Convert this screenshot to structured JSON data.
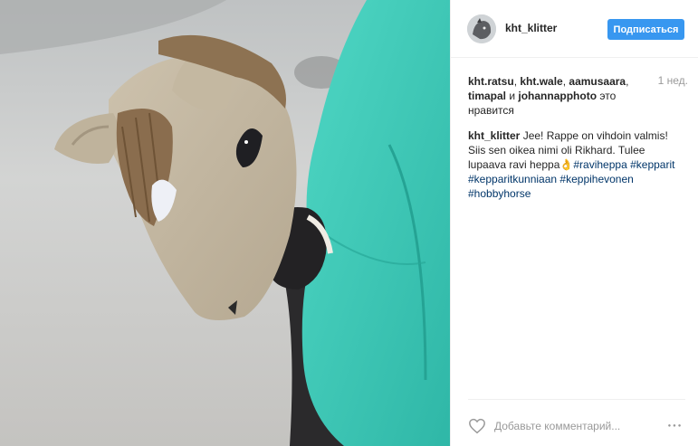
{
  "post": {
    "author": "kht_klitter",
    "follow_label": "Подписаться",
    "timestamp": "1 нед.",
    "photo_subject": "hobby horse",
    "avatar_subject": "hobby horse"
  },
  "likes": {
    "users": [
      "kht.ratsu",
      "kht.wale",
      "aamusaara",
      "timapal",
      "johannapphoto"
    ],
    "sep1": ", ",
    "sep2": ", ",
    "sep3": ",",
    "sep4": " и ",
    "suffix": " это нравится"
  },
  "caption": {
    "username": "kht_klitter",
    "text": " Jee! Rappe on vihdoin valmis! Siis sen oikea nimi oli Rikhard. Tulee lupaava ravi heppa",
    "emoji": "👌",
    "hashtags": [
      "#raviheppa",
      "#kepparit",
      "#kepparitkunniaan",
      "#keppihevonen",
      "#hobbyhorse"
    ]
  },
  "comment": {
    "placeholder": "Добавьте комментарий...",
    "more_icon": "ellipsis-icon",
    "like_icon": "heart-icon"
  },
  "colors": {
    "follow_button": "#3897f0",
    "hashtag": "#003569",
    "muted": "#999999",
    "jacket": "#3ec9b6"
  }
}
